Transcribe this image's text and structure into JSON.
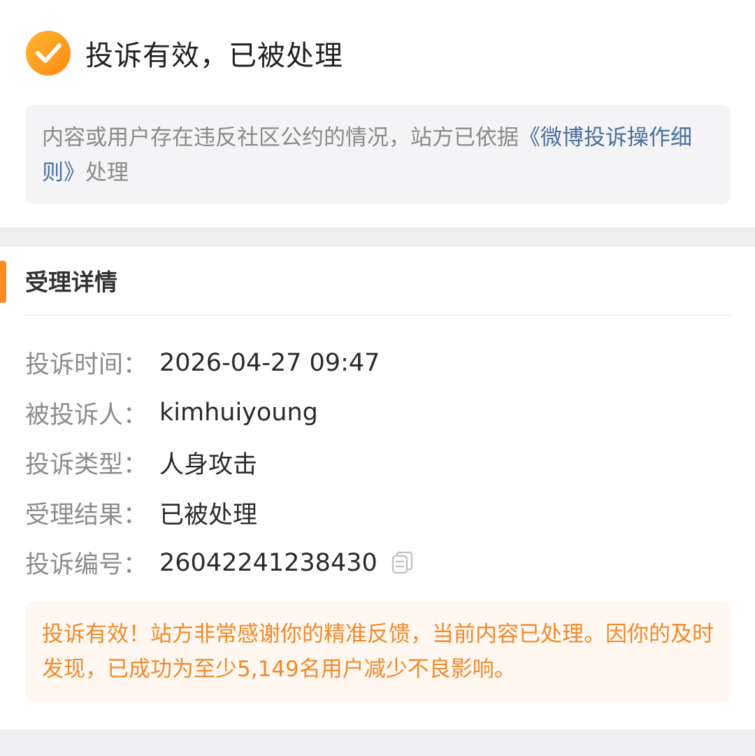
{
  "status": {
    "title": "投诉有效，已被处理",
    "icon": "check-circle-icon",
    "icon_color": "#ff9a1f"
  },
  "notice": {
    "text_before": "内容或用户存在违反社区公约的情况，站方已依据",
    "link_text": "《微博投诉操作细则》",
    "text_after": "处理"
  },
  "details": {
    "section_title": "受理详情",
    "accent_color": "#ff8a1f",
    "rows": [
      {
        "label": "投诉时间：",
        "value": "2026-04-27 09:47"
      },
      {
        "label": "被投诉人：",
        "value": "kimhuiyoung"
      },
      {
        "label": "投诉类型：",
        "value": "人身攻击"
      },
      {
        "label": "受理结果：",
        "value": "已被处理"
      },
      {
        "label": "投诉编号：",
        "value": "26042241238430"
      }
    ],
    "copy_icon": "copy-icon"
  },
  "thanks": {
    "text": "投诉有效！站方非常感谢你的精准反馈，当前内容已处理。因你的及时发现，已成功为至少5,149名用户减少不良影响。",
    "color": "#f08a2c"
  }
}
